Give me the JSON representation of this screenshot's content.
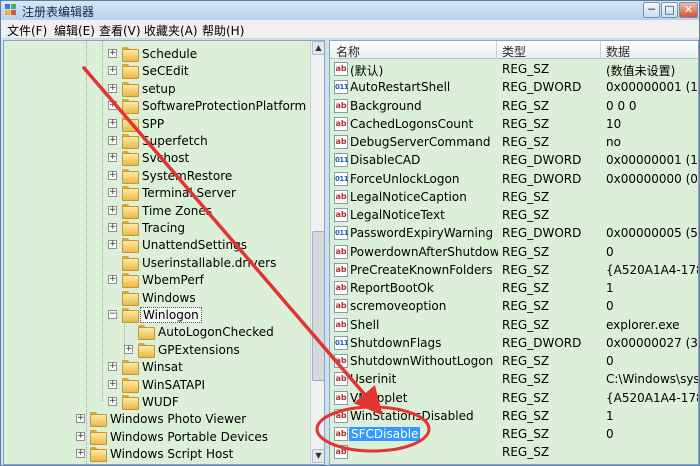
{
  "window": {
    "title": "注册表编辑器",
    "controls": {
      "minimize": "─",
      "maximize": "□",
      "close": "✕"
    }
  },
  "menu": [
    "文件(F)",
    "编辑(E)",
    "查看(V)",
    "收藏夹(A)",
    "帮助(H)"
  ],
  "tree": {
    "items": [
      {
        "label": "Schedule",
        "expander": "+"
      },
      {
        "label": "SeCEdit",
        "expander": "+"
      },
      {
        "label": "setup",
        "expander": "+"
      },
      {
        "label": "SoftwareProtectionPlatform",
        "expander": "+"
      },
      {
        "label": "SPP",
        "expander": "+"
      },
      {
        "label": "Superfetch",
        "expander": "+"
      },
      {
        "label": "Svchost",
        "expander": "+"
      },
      {
        "label": "SystemRestore",
        "expander": "+"
      },
      {
        "label": "Terminal Server",
        "expander": "+"
      },
      {
        "label": "Time Zones",
        "expander": "+"
      },
      {
        "label": "Tracing",
        "expander": "+"
      },
      {
        "label": "UnattendSettings",
        "expander": "+"
      },
      {
        "label": "Userinstallable.drivers",
        "expander": ""
      },
      {
        "label": "WbemPerf",
        "expander": "+"
      },
      {
        "label": "Windows",
        "expander": ""
      },
      {
        "label": "Winlogon",
        "expander": "−"
      },
      {
        "label": "AutoLogonChecked",
        "expander": ""
      },
      {
        "label": "GPExtensions",
        "expander": "+"
      },
      {
        "label": "Winsat",
        "expander": "+"
      },
      {
        "label": "WinSATAPI",
        "expander": "+"
      },
      {
        "label": "WUDF",
        "expander": "+"
      },
      {
        "label": "Windows Photo Viewer",
        "expander": "+"
      },
      {
        "label": "Windows Portable Devices",
        "expander": "+"
      },
      {
        "label": "Windows Script Host",
        "expander": "+"
      }
    ]
  },
  "list": {
    "columns": {
      "name": "名称",
      "type": "类型",
      "data": "数据"
    },
    "rows": [
      {
        "name": "(默认)",
        "type": "REG_SZ",
        "data": "(数值未设置)",
        "icon": "ab"
      },
      {
        "name": "AutoRestartShell",
        "type": "REG_DWORD",
        "data": "0x00000001 (1)",
        "icon": "bin"
      },
      {
        "name": "Background",
        "type": "REG_SZ",
        "data": "0 0 0",
        "icon": "ab"
      },
      {
        "name": "CachedLogonsCount",
        "type": "REG_SZ",
        "data": "10",
        "icon": "ab"
      },
      {
        "name": "DebugServerCommand",
        "type": "REG_SZ",
        "data": "no",
        "icon": "ab"
      },
      {
        "name": "DisableCAD",
        "type": "REG_DWORD",
        "data": "0x00000001 (1)",
        "icon": "bin"
      },
      {
        "name": "ForceUnlockLogon",
        "type": "REG_DWORD",
        "data": "0x00000000 (0)",
        "icon": "bin"
      },
      {
        "name": "LegalNoticeCaption",
        "type": "REG_SZ",
        "data": "",
        "icon": "ab"
      },
      {
        "name": "LegalNoticeText",
        "type": "REG_SZ",
        "data": "",
        "icon": "ab"
      },
      {
        "name": "PasswordExpiryWarning",
        "type": "REG_DWORD",
        "data": "0x00000005 (5)",
        "icon": "bin"
      },
      {
        "name": "PowerdownAfterShutdown",
        "type": "REG_SZ",
        "data": "0",
        "icon": "ab"
      },
      {
        "name": "PreCreateKnownFolders",
        "type": "REG_SZ",
        "data": "{A520A1A4-1780-4",
        "icon": "ab"
      },
      {
        "name": "ReportBootOk",
        "type": "REG_SZ",
        "data": "1",
        "icon": "ab"
      },
      {
        "name": "scremoveoption",
        "type": "REG_SZ",
        "data": "0",
        "icon": "ab"
      },
      {
        "name": "Shell",
        "type": "REG_SZ",
        "data": "explorer.exe",
        "icon": "ab"
      },
      {
        "name": "ShutdownFlags",
        "type": "REG_DWORD",
        "data": "0x00000027 (39)",
        "icon": "bin"
      },
      {
        "name": "ShutdownWithoutLogon",
        "type": "REG_SZ",
        "data": "0",
        "icon": "ab"
      },
      {
        "name": "Userinit",
        "type": "REG_SZ",
        "data": "C:\\Windows\\syster",
        "icon": "ab"
      },
      {
        "name": "VMApplet",
        "type": "REG_SZ",
        "data": "{A520A1A4-1780-4",
        "icon": "ab"
      },
      {
        "name": "WinStationsDisabled",
        "type": "REG_SZ",
        "data": "1",
        "icon": "ab"
      },
      {
        "name": "SFCDisable",
        "type": "REG_SZ",
        "data": "0",
        "icon": "ab",
        "selected": true
      },
      {
        "name": "",
        "type": "REG_SZ",
        "data": "",
        "icon": "ab"
      }
    ]
  },
  "annotation": {
    "color": "#e3342f"
  }
}
